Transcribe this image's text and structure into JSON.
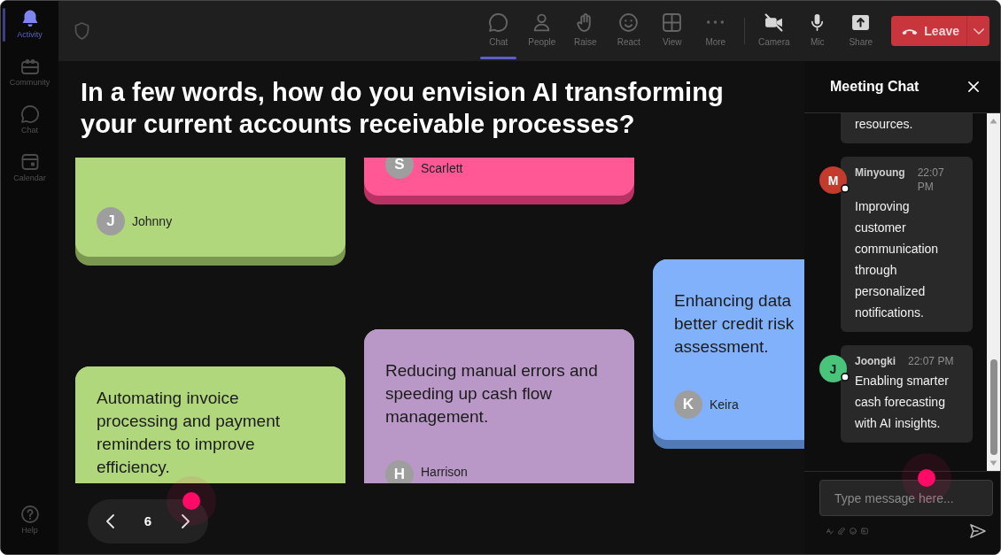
{
  "sidebar": {
    "items": [
      {
        "label": "Activity",
        "selected": true
      },
      {
        "label": "Community",
        "selected": false
      },
      {
        "label": "Chat",
        "selected": false
      },
      {
        "label": "Calendar",
        "selected": false
      }
    ],
    "help": {
      "label": "Help"
    }
  },
  "toolbar": {
    "items": [
      {
        "label": "Chat",
        "selected": true
      },
      {
        "label": "People",
        "selected": false
      },
      {
        "label": "Raise",
        "selected": false
      },
      {
        "label": "React",
        "selected": false
      },
      {
        "label": "View",
        "selected": false
      },
      {
        "label": "More",
        "selected": false
      }
    ],
    "device_items": [
      {
        "label": "Camera"
      },
      {
        "label": "Mic"
      },
      {
        "label": "Share"
      }
    ],
    "leave_button": {
      "label": "Leave"
    }
  },
  "question": {
    "title": "In a few words, how do you envision AI transforming your current accounts receivable processes?"
  },
  "board": {
    "columns": [
      {
        "cards": [
          {
            "color": "#b1d77c",
            "author": "Johnny",
            "initial": "J"
          },
          {
            "color": "#b1d77c",
            "text": "Automating invoice processing and payment reminders to improve efficiency."
          }
        ]
      },
      {
        "cards": [
          {
            "color": "#ff5895",
            "author": "Scarlett",
            "initial": "S"
          },
          {
            "color": "#b998c7",
            "text": "Reducing manual errors and speeding up cash flow management.",
            "author": "Harrison",
            "initial": "H"
          }
        ]
      },
      {
        "cards": [
          {
            "color": "#80b1fa",
            "text": "Enhancing data\nbetter credit risk\nassessment.",
            "author": "Keira",
            "initial": "K"
          }
        ]
      }
    ]
  },
  "pagination": {
    "page": "6"
  },
  "chat": {
    "title": "Meeting Chat",
    "messages": [
      {
        "text": "resources."
      },
      {
        "author": "Minyoung",
        "initial": "M",
        "color": "#c23b2c",
        "time": "22:07 PM",
        "text": "Improving customer communication through personalized notifications."
      },
      {
        "author": "Joongki",
        "initial": "J",
        "color": "#48c57a",
        "time": "22:07 PM",
        "text": "Enabling smarter cash forecasting with AI insights."
      }
    ],
    "input": {
      "placeholder": "Type message here..."
    }
  }
}
